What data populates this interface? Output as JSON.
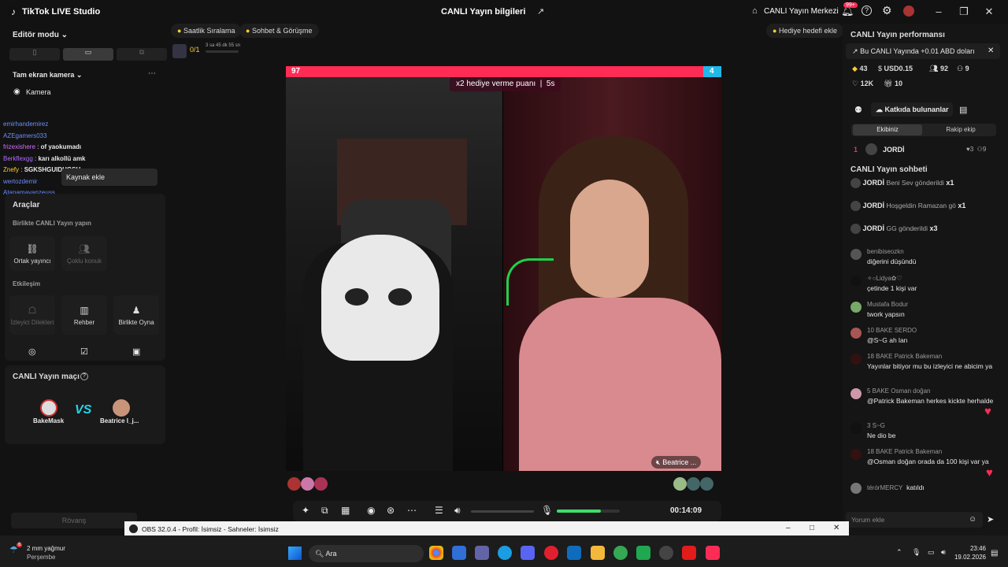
{
  "app": {
    "title": "TikTok LIVE Studio",
    "center_title": "CANLI Yayın bilgileri",
    "live_center": "CANLI Yayın Merkezi",
    "notif": "99+"
  },
  "left": {
    "editor_mode": "Editör modu",
    "fullscreen_cam": "Tam ekran kamera",
    "camera": "Kamera",
    "add_source": "Kaynak ekle",
    "tools": "Araçlar",
    "together": "Birlikte CANLI Yayın yapın",
    "cohost": "Ortak yayıncı",
    "multiguest": "Çoklu konuk",
    "interaction": "Etkileşim",
    "viewer_requests": "İzleyici Dilekleri",
    "guide": "Rehber",
    "play_together": "Birlikte Oyna",
    "match": "CANLI Yayın maçı",
    "p1": "BakeMask",
    "p2": "Beatrice I_j...",
    "vs": "VS",
    "rematch": "Rövanş",
    "chat": [
      {
        "u": "emirhandemirez",
        "t": ""
      },
      {
        "u": "AZEgamers033",
        "t": ""
      },
      {
        "u": "frizexishere",
        "t": "of yaokumadı"
      },
      {
        "u": "Berkflexgg",
        "t": "karı alkollü amk"
      },
      {
        "u": "Znefy",
        "t": "SGKSHGUIDHGSU"
      },
      {
        "u": "wertozdemir",
        "t": ""
      },
      {
        "u": "Atanamayanzeuss",
        "t": ""
      }
    ]
  },
  "top": {
    "ranking": "Saatlik Sıralama",
    "chat_meet": "Sohbet & Görüşme",
    "gift_goal": "Hediye hedefi ekle",
    "goal": "0/1",
    "timer": "3 sa 45 dk 55 sn"
  },
  "battle": {
    "left_score": "97",
    "right_score": "4",
    "banner": "x2 hediye verme puanı",
    "banner_time": "5s",
    "right_name": "Beatrice ..."
  },
  "controls": {
    "time": "00:14:09"
  },
  "right": {
    "perf": "CANLI Yayın performansı",
    "earn": "Bu CANLI Yayında +0.01 ABD doları",
    "s1": "43",
    "s2": "USD0.15",
    "s3": "92",
    "s4": "9",
    "s5": "12K",
    "s6": "10",
    "contrib": "Katkıda bulunanlar",
    "our": "Ekibiniz",
    "opp": "Rakip ekip",
    "rank": "1",
    "rank_user": "JORDİ",
    "rank_likes": "3",
    "rank_n": "9",
    "chat_title": "CANLI Yayın sohbeti",
    "gifts": [
      {
        "u": "JORDİ",
        "t": "Beni Sev gönderildi",
        "x": "x1"
      },
      {
        "u": "JORDİ",
        "t": "Hoşgeldin Ramazan gö",
        "x": "x1"
      },
      {
        "u": "JORDİ",
        "t": "GG gönderildi",
        "x": "x3"
      }
    ],
    "messages": [
      {
        "u": "benibiseozkn",
        "t": "diğerini düşündü"
      },
      {
        "u": "✧○Lidya✿♡",
        "t": "çetinde 1 kişi var"
      },
      {
        "u": "Mustafa Bodur",
        "t": "twork yapsın"
      },
      {
        "u": "10  BAKE  SERDO",
        "t": "@S~G ah lan"
      },
      {
        "u": "18  BAKE  Patrick Bakeman",
        "t": "Yayınlar bitiyor mu bu izleyici ne abicim ya"
      },
      {
        "u": "5  BAKE  Osman doğan",
        "t": "@Patrick Bakeman herkes kickte herhalde"
      },
      {
        "u": "3  S~G",
        "t": "Ne dio be"
      },
      {
        "u": "18  BAKE  Patrick Bakeman",
        "t": "@Osman doğan orada da 100 kişi var ya"
      },
      {
        "u": "térórMERCY",
        "t": "katıldı"
      }
    ],
    "comment_ph": "Yorum ekle"
  },
  "obs": {
    "title": "OBS 32.0.4 - Profil: İsimsiz - Sahneler: İsimsiz"
  },
  "taskbar": {
    "weather": "2 mm yağmur",
    "day": "Perşembe",
    "search": "Ara",
    "time": "23:46",
    "date": "19.02.2026",
    "badge": "6"
  }
}
